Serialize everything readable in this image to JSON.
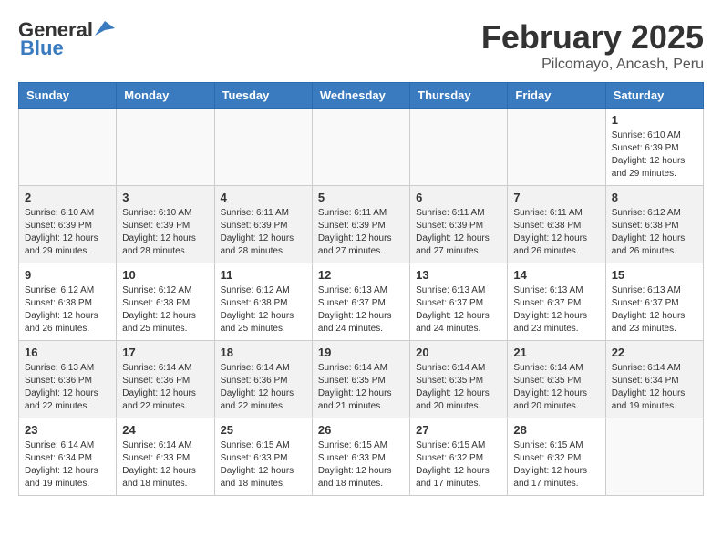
{
  "header": {
    "logo_general": "General",
    "logo_blue": "Blue",
    "month": "February 2025",
    "location": "Pilcomayo, Ancash, Peru"
  },
  "weekdays": [
    "Sunday",
    "Monday",
    "Tuesday",
    "Wednesday",
    "Thursday",
    "Friday",
    "Saturday"
  ],
  "weeks": [
    {
      "shaded": false,
      "days": [
        {
          "num": "",
          "info": ""
        },
        {
          "num": "",
          "info": ""
        },
        {
          "num": "",
          "info": ""
        },
        {
          "num": "",
          "info": ""
        },
        {
          "num": "",
          "info": ""
        },
        {
          "num": "",
          "info": ""
        },
        {
          "num": "1",
          "info": "Sunrise: 6:10 AM\nSunset: 6:39 PM\nDaylight: 12 hours and 29 minutes."
        }
      ]
    },
    {
      "shaded": true,
      "days": [
        {
          "num": "2",
          "info": "Sunrise: 6:10 AM\nSunset: 6:39 PM\nDaylight: 12 hours and 29 minutes."
        },
        {
          "num": "3",
          "info": "Sunrise: 6:10 AM\nSunset: 6:39 PM\nDaylight: 12 hours and 28 minutes."
        },
        {
          "num": "4",
          "info": "Sunrise: 6:11 AM\nSunset: 6:39 PM\nDaylight: 12 hours and 28 minutes."
        },
        {
          "num": "5",
          "info": "Sunrise: 6:11 AM\nSunset: 6:39 PM\nDaylight: 12 hours and 27 minutes."
        },
        {
          "num": "6",
          "info": "Sunrise: 6:11 AM\nSunset: 6:39 PM\nDaylight: 12 hours and 27 minutes."
        },
        {
          "num": "7",
          "info": "Sunrise: 6:11 AM\nSunset: 6:38 PM\nDaylight: 12 hours and 26 minutes."
        },
        {
          "num": "8",
          "info": "Sunrise: 6:12 AM\nSunset: 6:38 PM\nDaylight: 12 hours and 26 minutes."
        }
      ]
    },
    {
      "shaded": false,
      "days": [
        {
          "num": "9",
          "info": "Sunrise: 6:12 AM\nSunset: 6:38 PM\nDaylight: 12 hours and 26 minutes."
        },
        {
          "num": "10",
          "info": "Sunrise: 6:12 AM\nSunset: 6:38 PM\nDaylight: 12 hours and 25 minutes."
        },
        {
          "num": "11",
          "info": "Sunrise: 6:12 AM\nSunset: 6:38 PM\nDaylight: 12 hours and 25 minutes."
        },
        {
          "num": "12",
          "info": "Sunrise: 6:13 AM\nSunset: 6:37 PM\nDaylight: 12 hours and 24 minutes."
        },
        {
          "num": "13",
          "info": "Sunrise: 6:13 AM\nSunset: 6:37 PM\nDaylight: 12 hours and 24 minutes."
        },
        {
          "num": "14",
          "info": "Sunrise: 6:13 AM\nSunset: 6:37 PM\nDaylight: 12 hours and 23 minutes."
        },
        {
          "num": "15",
          "info": "Sunrise: 6:13 AM\nSunset: 6:37 PM\nDaylight: 12 hours and 23 minutes."
        }
      ]
    },
    {
      "shaded": true,
      "days": [
        {
          "num": "16",
          "info": "Sunrise: 6:13 AM\nSunset: 6:36 PM\nDaylight: 12 hours and 22 minutes."
        },
        {
          "num": "17",
          "info": "Sunrise: 6:14 AM\nSunset: 6:36 PM\nDaylight: 12 hours and 22 minutes."
        },
        {
          "num": "18",
          "info": "Sunrise: 6:14 AM\nSunset: 6:36 PM\nDaylight: 12 hours and 22 minutes."
        },
        {
          "num": "19",
          "info": "Sunrise: 6:14 AM\nSunset: 6:35 PM\nDaylight: 12 hours and 21 minutes."
        },
        {
          "num": "20",
          "info": "Sunrise: 6:14 AM\nSunset: 6:35 PM\nDaylight: 12 hours and 20 minutes."
        },
        {
          "num": "21",
          "info": "Sunrise: 6:14 AM\nSunset: 6:35 PM\nDaylight: 12 hours and 20 minutes."
        },
        {
          "num": "22",
          "info": "Sunrise: 6:14 AM\nSunset: 6:34 PM\nDaylight: 12 hours and 19 minutes."
        }
      ]
    },
    {
      "shaded": false,
      "days": [
        {
          "num": "23",
          "info": "Sunrise: 6:14 AM\nSunset: 6:34 PM\nDaylight: 12 hours and 19 minutes."
        },
        {
          "num": "24",
          "info": "Sunrise: 6:14 AM\nSunset: 6:33 PM\nDaylight: 12 hours and 18 minutes."
        },
        {
          "num": "25",
          "info": "Sunrise: 6:15 AM\nSunset: 6:33 PM\nDaylight: 12 hours and 18 minutes."
        },
        {
          "num": "26",
          "info": "Sunrise: 6:15 AM\nSunset: 6:33 PM\nDaylight: 12 hours and 18 minutes."
        },
        {
          "num": "27",
          "info": "Sunrise: 6:15 AM\nSunset: 6:32 PM\nDaylight: 12 hours and 17 minutes."
        },
        {
          "num": "28",
          "info": "Sunrise: 6:15 AM\nSunset: 6:32 PM\nDaylight: 12 hours and 17 minutes."
        },
        {
          "num": "",
          "info": ""
        }
      ]
    }
  ]
}
